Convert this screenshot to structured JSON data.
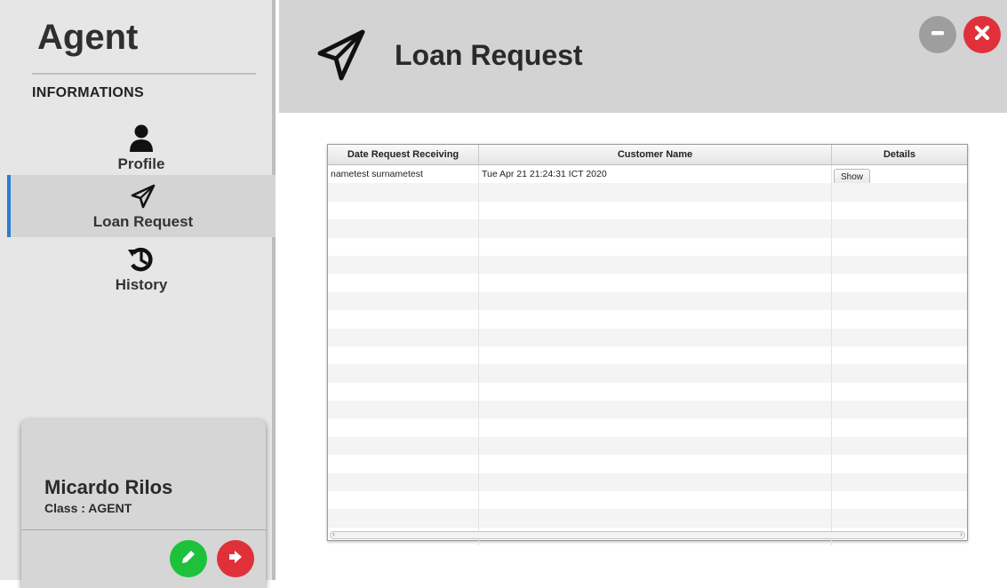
{
  "app": {
    "title": "Agent"
  },
  "sidebar": {
    "section_label": "INFORMATIONS",
    "items": [
      {
        "label": "Profile",
        "icon": "user-icon"
      },
      {
        "label": "Loan Request",
        "icon": "paper-plane-icon",
        "active": true
      },
      {
        "label": "History",
        "icon": "history-icon"
      }
    ],
    "accent_color": "#2a7dd6"
  },
  "user": {
    "name": "Micardo Rilos",
    "class_text": "Class : AGENT",
    "edit_icon": "pencil-icon",
    "logout_icon": "sign-out-icon"
  },
  "header": {
    "title": "Loan Request",
    "icon": "paper-plane-icon",
    "minimize_icon": "minus-icon",
    "close_icon": "close-icon"
  },
  "table": {
    "columns": [
      "Date Request Receiving",
      "Customer Name",
      "Details"
    ],
    "rows": [
      {
        "col1": "nametest surnametest",
        "col2": "Tue Apr 21 21:24:31 ICT 2020",
        "action": "Show"
      }
    ]
  },
  "colors": {
    "green": "#1ec13c",
    "red": "#e0313a",
    "gray_button": "#9e9e9e"
  }
}
